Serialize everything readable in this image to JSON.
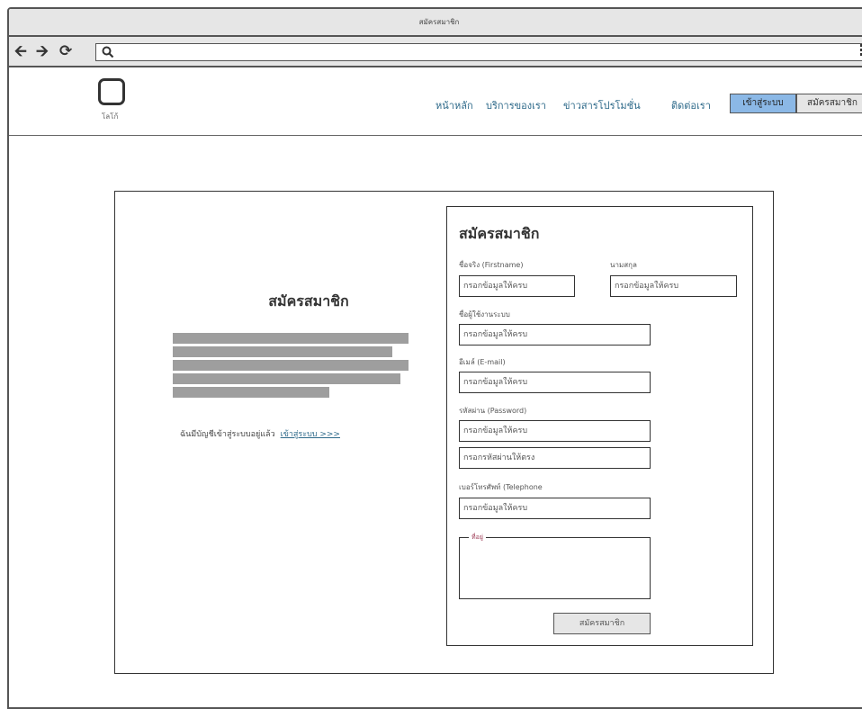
{
  "window": {
    "title": "สมัครสมาชิก"
  },
  "browser": {
    "back_icon": "arrow-left-icon",
    "forward_icon": "arrow-right-icon",
    "reload_icon": "reload-icon",
    "search_icon": "search-icon",
    "menu_icon": "hamburger-menu-icon",
    "url_value": ""
  },
  "header": {
    "logo_label": "โลโก้",
    "nav": [
      "หน้าหลัก",
      "บริการของเรา",
      "ข่าวสารโปรโมชั่น",
      "ติดต่อเรา"
    ],
    "login_button": "เข้าสู่ระบบ",
    "signup_button": "สมัครสมาชิก",
    "colors": {
      "primary_button": "#8bb8e6",
      "link": "#2e6a8a"
    }
  },
  "left": {
    "title": "สมัครสมาชิก",
    "have_account_text": "ฉันมีบัญชีเข้าสู่ระบบอยู่แล้ว",
    "login_link": "เข้าสู่ระบบ >>>"
  },
  "form": {
    "title": "สมัครสมาชิก",
    "firstname_label": "ชื่อจริง (Firstname)",
    "lastname_label": "นามสกุล",
    "username_label": "ชื่อผู้ใช้งานระบบ",
    "email_label": "อีเมล์ (E-mail)",
    "password_label": "รหัสผ่าน (Password)",
    "phone_label": "เบอร์โทรศัพท์ (Telephone",
    "placeholder": "กรอกข้อมูลให้ครบ",
    "confirm_placeholder": "กรอกรหัสผ่านให้ตรง",
    "address_label": "ที่อยู่",
    "submit": "สมัครสมาชิก"
  }
}
